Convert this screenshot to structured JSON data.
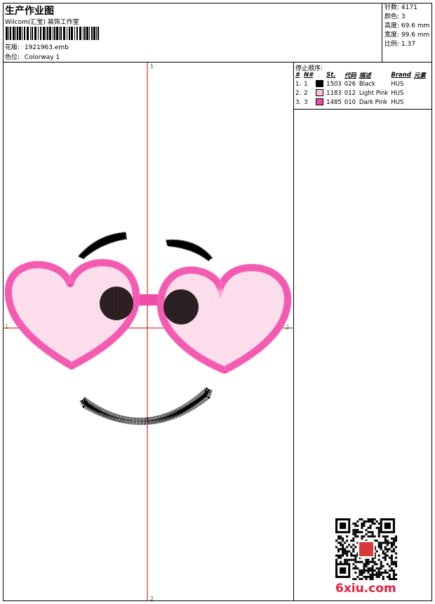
{
  "header": {
    "title": "生产作业图",
    "company": "Wilcom(汇宝) 装饰工作室",
    "design_label": "花版:",
    "design_value": "1921963.emb",
    "colorway_label": "色位:",
    "colorway_value": "Colorway 1"
  },
  "stats": [
    {
      "label": "针数:",
      "value": "4171"
    },
    {
      "label": "颜色:",
      "value": "3"
    },
    {
      "label": "高度:",
      "value": "69.6 mm"
    },
    {
      "label": "宽度:",
      "value": "99.6 mm"
    },
    {
      "label": "比例:",
      "value": "1.37"
    }
  ],
  "stop_sequence": {
    "title": "停止顺序:",
    "columns": [
      "#",
      "N#",
      "St.",
      "代码",
      "描述",
      "Brand",
      "元素"
    ],
    "rows": [
      {
        "idx": "1.",
        "n": "1",
        "color": "#000000",
        "st": "1503",
        "code": "026",
        "desc": "Black",
        "brand": "HUS"
      },
      {
        "idx": "2.",
        "n": "2",
        "color": "#FFC0DC",
        "st": "1183",
        "code": "012",
        "desc": "Light Pink",
        "brand": "HUS"
      },
      {
        "idx": "3.",
        "n": "3",
        "color": "#F04CA8",
        "st": "1485",
        "code": "010",
        "desc": "Dark Pink",
        "brand": "HUS"
      }
    ]
  },
  "crosshair": {
    "top": "1",
    "bottom": "2",
    "left": "1",
    "right": "2"
  },
  "watermark": {
    "site": "6xiu.com"
  },
  "colors": {
    "guide": "#d40000",
    "light_pink": "#FFC0DC",
    "dark_pink": "#F04CA8",
    "black": "#000000"
  }
}
